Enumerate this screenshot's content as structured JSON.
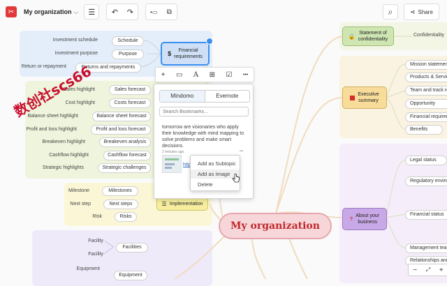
{
  "header": {
    "logo_glyph": "✂",
    "doc_title": "My organization",
    "chevron": "⌵",
    "menu_glyph": "☰",
    "undo_glyph": "↶",
    "redo_glyph": "↷",
    "insert_glyph": "•▭",
    "layout_glyph": "⧉",
    "search_glyph": "⌕",
    "share_glyph": "⋖",
    "share_label": "Share"
  },
  "colors": {
    "accent": "#e03a3a",
    "central_fill": "#f7d6d9",
    "central_text": "#c0282c",
    "selected": "#3a8ff0"
  },
  "watermark": "数创社scs66",
  "central_topic": "My organization",
  "financial_topic": {
    "icon": "$",
    "label_line1": "Financial",
    "label_line2": "requirements"
  },
  "financial_items": [
    {
      "label": "Investment schedule",
      "pill": "Schedule"
    },
    {
      "label": "Investment purpose",
      "pill": "Purpose"
    },
    {
      "label": "Return or repayment",
      "pill": "Returns and repayments"
    }
  ],
  "highlights": [
    {
      "label": "Sales highlight",
      "pill": "Sales forecast"
    },
    {
      "label": "Cost highlight",
      "pill": "Costs forecast"
    },
    {
      "label": "Balance sheet highlight",
      "pill": "Balance sheet forecast"
    },
    {
      "label": "Profit and loss highlight",
      "pill": "Profit and loss forecast"
    },
    {
      "label": "Breakeven highlight",
      "pill": "Breakeven analysis"
    },
    {
      "label": "Cashflow highlight",
      "pill": "Cashflow forecast"
    },
    {
      "label": "Strategic highlights",
      "pill": "Strategic challenges"
    }
  ],
  "implementation_topic": "Implementation",
  "implementation_items": [
    {
      "label": "Milestone",
      "pill": "Milestones"
    },
    {
      "label": "Next step",
      "pill": "Next steps"
    },
    {
      "label": "Risk",
      "pill": "Risks"
    }
  ],
  "facilities": {
    "labels": [
      "Facility",
      "Facility",
      "Equipment"
    ],
    "pills": [
      "Facilities",
      "Equipment"
    ]
  },
  "right_topics": {
    "statement": {
      "line1": "Statement of",
      "line2": "confidentiality",
      "child": "Confidentiality"
    },
    "executive": {
      "line1": "Executive",
      "line2": "summary",
      "children": [
        "Mission statement",
        "Products & Services",
        "Team and track record",
        "Opportunity",
        "Financial requirements",
        "Benefits"
      ]
    },
    "business": {
      "icon": "?",
      "line1": "About your",
      "line2": "business",
      "children": [
        "Legal status",
        "Regulatory environment",
        "Financial status",
        "Management team",
        "Relationships and"
      ]
    }
  },
  "zoom": {
    "minus": "−",
    "plus": "+",
    "fit": "⤢"
  },
  "toolbar_float": {
    "add": "+",
    "shape": "▭",
    "text": "A",
    "tree": "⊞",
    "check": "☑",
    "more": "•••"
  },
  "bookmarks": {
    "tabs": [
      "Mindomo",
      "Evernote"
    ],
    "search_placeholder": "Search Bookmarks...",
    "snippet": "tomorrow are visionaries who apply their knowledge with mind mapping to solve problems and make smart decisions.",
    "time": "2 minutes ago",
    "link_text": "http",
    "more": "•••"
  },
  "context_menu": [
    "Add as Subtopic",
    "Add as Image",
    "Delete"
  ]
}
